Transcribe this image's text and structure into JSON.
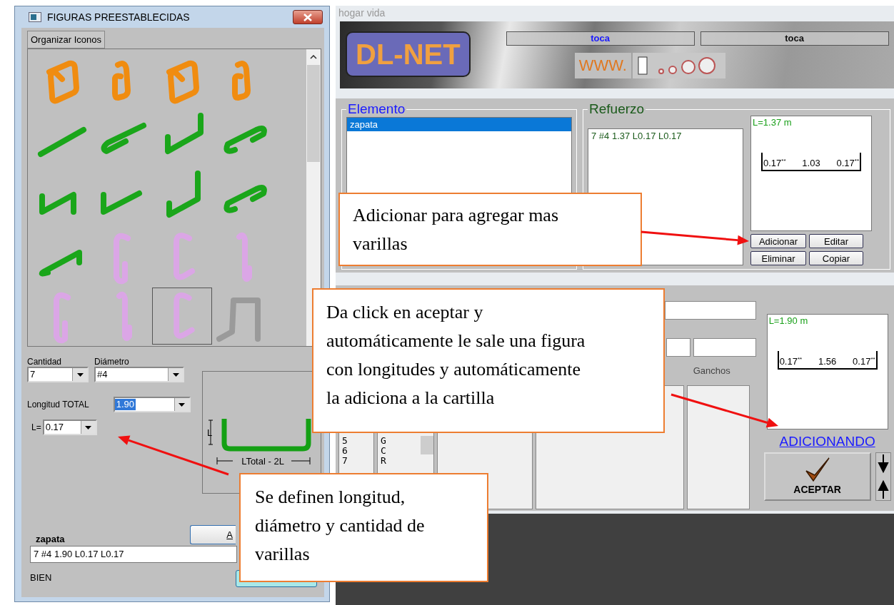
{
  "dialog": {
    "title": "FIGURAS PREESTABLECIDAS",
    "tab": "Organizar Iconos",
    "figures": [
      {
        "kind": "loop",
        "color": "#f08c10",
        "selected": false
      },
      {
        "kind": "loopnarrow",
        "color": "#f08c10",
        "selected": false
      },
      {
        "kind": "loop",
        "color": "#f08c10",
        "selected": false
      },
      {
        "kind": "loopnarrow",
        "color": "#f08c10",
        "selected": false
      },
      {
        "kind": "straight",
        "color": "#1aa61a",
        "selected": false
      },
      {
        "kind": "hairpin",
        "color": "#1aa61a",
        "selected": false
      },
      {
        "kind": "ushape",
        "color": "#1aa61a",
        "selected": false
      },
      {
        "kind": "hook",
        "color": "#1aa61a",
        "selected": false
      },
      {
        "kind": "zigzag",
        "color": "#1aa61a",
        "selected": false
      },
      {
        "kind": "vee",
        "color": "#1aa61a",
        "selected": false
      },
      {
        "kind": "jay",
        "color": "#1aa61a",
        "selected": false
      },
      {
        "kind": "hook",
        "color": "#1aa61a",
        "selected": false
      },
      {
        "kind": "crank",
        "color": "#1aa61a",
        "selected": false
      },
      {
        "kind": "gpin",
        "color": "#dba6e6",
        "selected": false
      },
      {
        "kind": "cpin",
        "color": "#dba6e6",
        "selected": false
      },
      {
        "kind": "slimpin",
        "color": "#dba6e6",
        "selected": false
      },
      {
        "kind": "gpin",
        "color": "#dba6e6",
        "selected": false
      },
      {
        "kind": "slimpin",
        "color": "#dba6e6",
        "selected": false
      },
      {
        "kind": "cpin",
        "color": "#dba6e6",
        "selected": true
      },
      {
        "kind": "frame",
        "color": "#9a9a9a",
        "selected": false
      }
    ],
    "quantity": {
      "label": "Cantidad",
      "value": "7"
    },
    "diameter": {
      "label": "Diámetro",
      "value": "#4"
    },
    "total_length": {
      "label": "Longitud TOTAL",
      "value": "1.90",
      "highlighted": true
    },
    "hook_length": {
      "label": "L=",
      "value": "0.17"
    },
    "diagram": {
      "left": "L",
      "bottom": "LTotal - 2L"
    },
    "element_name": "zapata",
    "button_partial": "A",
    "result": "7 #4 1.90 L0.17 L0.17",
    "status": "BIEN"
  },
  "app": {
    "title": "hogar vida",
    "logo": "DL-NET",
    "banner_fields": [
      {
        "label": "toca",
        "color": "#1a1aff"
      },
      {
        "label": "toca",
        "color": "#111111"
      }
    ],
    "web_badge": "WWW.",
    "elemento": {
      "legend": "Elemento",
      "items": [
        {
          "label": "zapata",
          "selected": true
        }
      ]
    },
    "refuerzo": {
      "legend": "Refuerzo",
      "items": [
        "7 #4 1.37 L0.17 L0.17"
      ],
      "preview": {
        "length": "L=1.37 m",
        "dims": [
          "0.17$^{**}$",
          "1.03",
          "0.17$^{**}$"
        ]
      },
      "buttons": [
        "Adicionar",
        "Editar",
        "Eliminar",
        "Copiar"
      ]
    },
    "detail": {
      "hooks_label": "Ganchos",
      "numbers": [
        "5",
        "6",
        "7"
      ],
      "codes": [
        "G",
        "C",
        "R"
      ],
      "preview": {
        "length": "L=1.90 m",
        "dims": [
          "0.17$^{**}$",
          "1.56",
          "0.17$^{**}$"
        ]
      },
      "mode": "ADICIONANDO",
      "accept": "ACEPTAR"
    }
  },
  "callouts": [
    {
      "lines": [
        "Adicionar para agregar mas",
        "varillas"
      ]
    },
    {
      "lines": [
        "Da click en aceptar y",
        "automáticamente le sale una figura",
        "con longitudes y automáticamente",
        "la adiciona a la cartilla"
      ]
    },
    {
      "lines": [
        "Se definen longitud,",
        "diámetro y cantidad de",
        "varillas"
      ]
    }
  ]
}
